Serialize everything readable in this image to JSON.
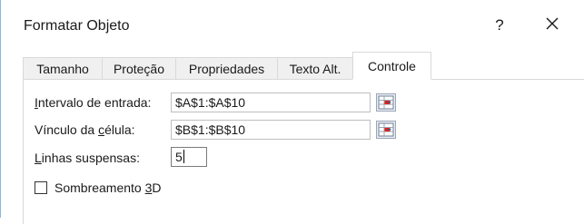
{
  "dialog": {
    "title": "Formatar Objeto",
    "help_label": "?"
  },
  "tabs": [
    {
      "label": "Tamanho"
    },
    {
      "label": "Proteção"
    },
    {
      "label": "Propriedades"
    },
    {
      "label": "Texto Alt."
    },
    {
      "label": "Controle",
      "active": true
    }
  ],
  "form": {
    "input_range": {
      "label_pre": "",
      "label_u": "I",
      "label_post": "ntervalo de entrada:",
      "value": "$A$1:$A$10"
    },
    "cell_link": {
      "label_pre": "Vínculo da ",
      "label_u": "c",
      "label_post": "élula:",
      "value": "$B$1:$B$10"
    },
    "dropdown_lines": {
      "label_pre": "",
      "label_u": "L",
      "label_post": "inhas suspensas:",
      "value": "5"
    },
    "shading_3d": {
      "label_pre": "Sombreamento ",
      "label_u": "3",
      "label_post": "D",
      "checked": false
    }
  },
  "colors": {
    "accent_border": "#8ab4e0",
    "tab_bg": "#f0f0f0",
    "ref_icon_red": "#d9241c"
  }
}
